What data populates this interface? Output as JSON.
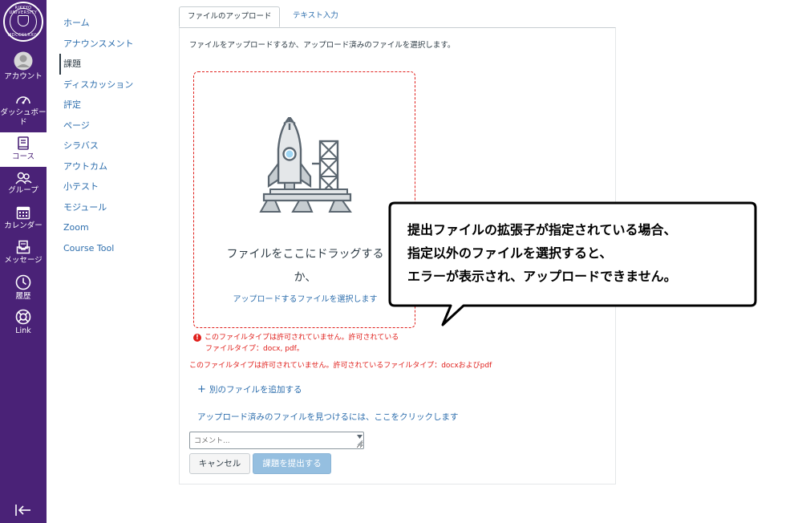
{
  "global_nav": {
    "logo_text_top": "RIKKYO UNIVERSITY",
    "logo_text_bottom": "MDCCCLXXIV",
    "items": [
      {
        "label": "アカウント",
        "icon": "avatar-icon"
      },
      {
        "label": "ダッシュボード",
        "icon": "dashboard-icon"
      },
      {
        "label": "コース",
        "icon": "book-icon"
      },
      {
        "label": "グループ",
        "icon": "group-icon"
      },
      {
        "label": "カレンダー",
        "icon": "calendar-icon"
      },
      {
        "label": "メッセージ",
        "icon": "inbox-icon"
      },
      {
        "label": "履歴",
        "icon": "clock-icon"
      },
      {
        "label": "Link",
        "icon": "lifebuoy-icon"
      }
    ],
    "collapse_icon": "collapse-nav-icon"
  },
  "course_nav": {
    "items": [
      "ホーム",
      "アナウンスメント",
      "課題",
      "ディスカッション",
      "評定",
      "ページ",
      "シラバス",
      "アウトカム",
      "小テスト",
      "モジュール",
      "Zoom",
      "Course Tool"
    ],
    "active": "課題"
  },
  "tabs": {
    "upload": "ファイルのアップロード",
    "text_entry": "テキスト入力"
  },
  "upload": {
    "instruction": "ファイルをアップロードするか、アップロード済みのファイルを選択します。",
    "drop_text_1": "ファイルをここにドラッグする",
    "drop_text_2": "か、",
    "select_link": "アップロードするファイルを選択します",
    "error_line1": "このファイルタイプは許可されていません。許可されている",
    "error_line2": "ファイルタイプ：docx, pdf。",
    "error_summary": "このファイルタイプは許可されていません。許可されているファイルタイプ：docxおよびpdf",
    "add_file": "別のファイルを追加する",
    "find_uploaded": "アップロード済みのファイルを見つけるには、ここをクリックします",
    "comment_placeholder": "コメント...",
    "cancel_label": "キャンセル",
    "submit_label": "課題を提出する"
  },
  "callout": {
    "line1": "提出ファイルの拡張子が指定されている場合、",
    "line2": "指定以外のファイルを選択すると、",
    "line3": "エラーが表示され、アップロードできません。"
  },
  "colors": {
    "nav_bg": "#4a2277",
    "link": "#2d6ead",
    "error": "#e0201c",
    "submit_bg": "#95bfe0"
  }
}
